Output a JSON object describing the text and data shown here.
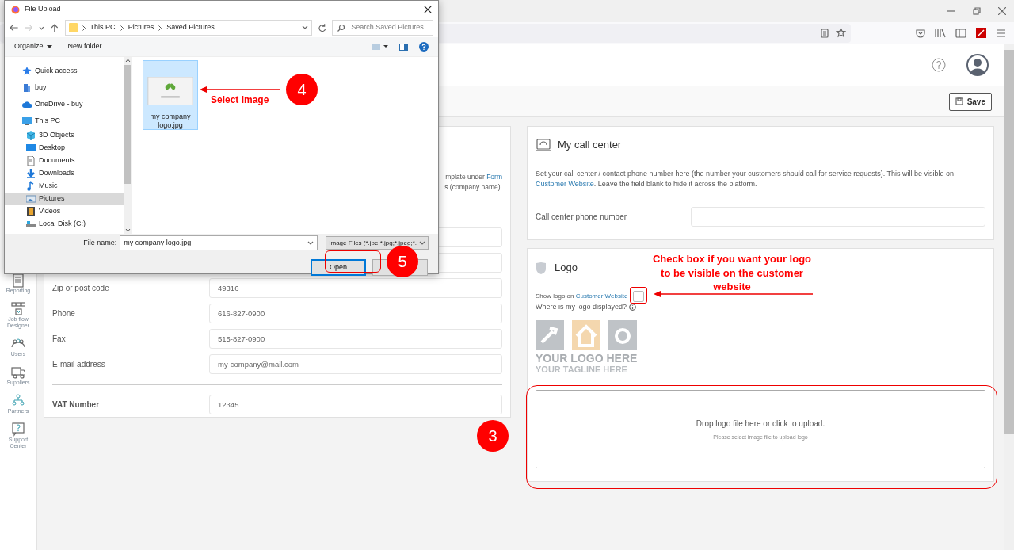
{
  "toolbar": {
    "save_button": "Save"
  },
  "sidebar": {
    "items": [
      {
        "label": "Reporting",
        "kind": "report"
      },
      {
        "label": "Job flow Designer",
        "kind": "workflow"
      },
      {
        "label": "Users",
        "kind": "users"
      },
      {
        "label": "Suppliers",
        "kind": "truck"
      },
      {
        "label": "Partners",
        "kind": "partners"
      },
      {
        "label": "Support Center",
        "kind": "support"
      }
    ]
  },
  "company_card": {
    "description_lines": [
      {
        "text": "mplate under",
        "link": "Form"
      },
      {
        "text": "s (company name)."
      }
    ],
    "fields": [
      {
        "label": "Zip or post code",
        "value": "49316"
      },
      {
        "label": "Phone",
        "value": "616-827-0900"
      },
      {
        "label": "Fax",
        "value": "515-827-0900"
      },
      {
        "label": "E-mail address",
        "value": "my-company@mail.com"
      }
    ],
    "vat_field": {
      "label": "VAT Number",
      "value": "12345"
    }
  },
  "call_center": {
    "title": "My call center",
    "description": {
      "text_before": "Set your call center / contact phone number here (the number your customers should call for service requests). This will be visible on",
      "link": "Customer Website",
      "text_after": ". Leave the field blank to hide it across the platform."
    },
    "field": {
      "label": "Call center phone number"
    }
  },
  "logo": {
    "title": "Logo",
    "show_logo": {
      "label": "Show logo on",
      "link": "Customer Website",
      "checked": false
    },
    "help": "Where is my logo displayed?",
    "placeholder_logo": {
      "line_1": "YOUR LOGO HERE",
      "line_2": "YOUR TAGLINE HERE"
    },
    "dropzone": {
      "title": "Drop logo file here or click to upload.",
      "hint": "Please select image file to upload logo"
    }
  },
  "dialog": {
    "title": "File Upload",
    "path": [
      "This PC",
      "Pictures",
      "Saved Pictures"
    ],
    "search_placeholder": "Search Saved Pictures",
    "commands": [
      "Organize",
      "New folder"
    ],
    "nav_tree": [
      {
        "label": "Quick access",
        "kind": "star",
        "selected": false
      },
      {
        "label": "buy",
        "kind": "user-folder",
        "selected": false
      },
      {
        "label": "OneDrive - buy",
        "kind": "cloud",
        "selected": false
      },
      {
        "label": "This PC",
        "kind": "computer",
        "selected": false,
        "children": [
          {
            "label": "3D Objects",
            "kind": "cube",
            "selected": false
          },
          {
            "label": "Desktop",
            "kind": "desktop",
            "selected": false
          },
          {
            "label": "Documents",
            "kind": "document",
            "selected": false
          },
          {
            "label": "Downloads",
            "kind": "download",
            "selected": false
          },
          {
            "label": "Music",
            "kind": "music",
            "selected": false
          },
          {
            "label": "Pictures",
            "kind": "picture",
            "selected": true
          },
          {
            "label": "Videos",
            "kind": "film",
            "selected": false
          },
          {
            "label": "Local Disk (C:)",
            "kind": "drive",
            "selected": false
          }
        ]
      }
    ],
    "files": [
      {
        "name": "my company logo.jpg",
        "selected": true
      }
    ],
    "file_name_label": "File name:",
    "file_name": "my company logo.jpg",
    "file_type": "Image Files (*.jpe;*.jpg;*.jpeg;*.",
    "open_button": "Open"
  },
  "annotations": {
    "select_image": "Select Image",
    "select_step": "4",
    "open_step": "5",
    "dropzone_step": "3",
    "checkbox_note": "Check box if you want your logo to be visible on the customer website"
  }
}
